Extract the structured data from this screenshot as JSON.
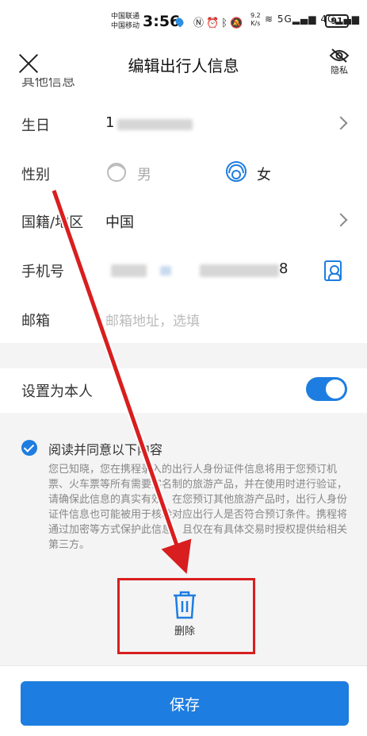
{
  "status_bar": {
    "carrier_1": "中国联通",
    "carrier_2": "中国移动",
    "time": "3:56",
    "net_speed_value": "9.2",
    "net_speed_unit": "K/s",
    "battery": "91"
  },
  "header": {
    "title": "编辑出行人信息",
    "privacy_label": "隐私"
  },
  "section_cut_label": "其他信息",
  "form": {
    "birthday": {
      "label": "生日",
      "value_prefix": "1"
    },
    "gender": {
      "label": "性别",
      "male": "男",
      "female": "女",
      "selected": "女"
    },
    "nationality": {
      "label": "国籍/地区",
      "value": "中国"
    },
    "phone": {
      "label": "手机号",
      "value_suffix": "8"
    },
    "email": {
      "label": "邮箱",
      "placeholder": "邮箱地址，选填"
    }
  },
  "set_self": {
    "label": "设置为本人",
    "enabled": true
  },
  "agreement": {
    "title": "阅读并同意以下内容",
    "text": "您已知晓，您在携程录入的出行人身份证件信息将用于您预订机票、火车票等所有需要实名制的旅游产品，并在使用时进行验证，请确保此信息的真实有效。在您预订其他旅游产品时，出行人身份证件信息也可能被用于核验对应出行人是否符合预订条件。携程将通过加密等方式保护此信息，且仅在有具体交易时授权提供给相关第三方。",
    "checked": true
  },
  "delete_label": "删除",
  "save_label": "保存",
  "colors": {
    "accent": "#1e7de0",
    "annotation": "#d81e1e"
  }
}
